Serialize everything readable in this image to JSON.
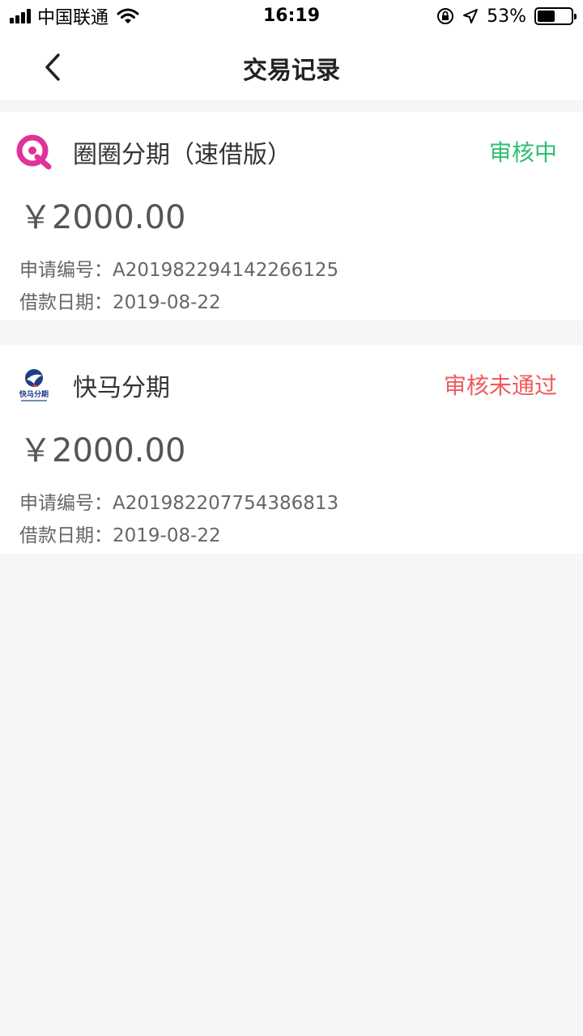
{
  "status_bar": {
    "carrier": "中国联通",
    "time": "16:19",
    "battery": "53%",
    "battery_level": 0.53
  },
  "header": {
    "title": "交易记录",
    "back_icon": "chevron-left-icon"
  },
  "records": [
    {
      "name": "圈圈分期（速借版）",
      "status": "审核中",
      "status_color": "#2fbf71",
      "amount": "￥2000.00",
      "app_no_label": "申请编号：",
      "app_no": "A201982294142266125",
      "date_label": "借款日期：",
      "date": "2019-08-22",
      "logo_icon": "quanquan-logo"
    },
    {
      "name": "快马分期",
      "status": "审核未通过",
      "status_color": "#ef5b5b",
      "amount": "￥2000.00",
      "app_no_label": "申请编号：",
      "app_no": "A201982207754386813",
      "date_label": "借款日期：",
      "date": "2019-08-22",
      "logo_icon": "kuaima-logo",
      "logo_text": "快马分期"
    }
  ]
}
